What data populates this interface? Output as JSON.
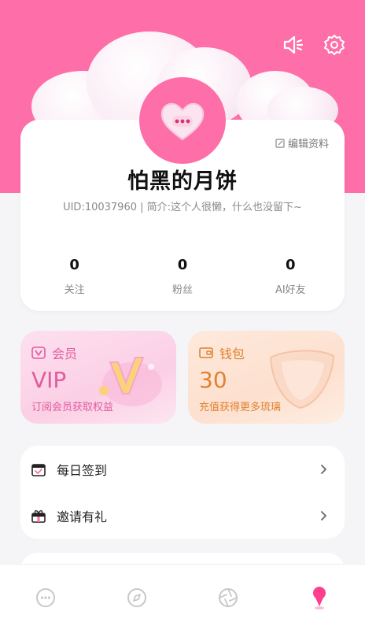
{
  "header": {
    "top_icons": [
      "speaker-icon",
      "gear-icon"
    ],
    "accent_color": "#fe6ea8"
  },
  "profile": {
    "edit_label": "编辑资料",
    "nickname": "怕黑的月饼",
    "uid_line": "UID:10037960 | 简介:这个人很懒，什么也没留下~",
    "stats": [
      {
        "value": "0",
        "label": "关注"
      },
      {
        "value": "0",
        "label": "粉丝"
      },
      {
        "value": "0",
        "label": "AI好友"
      }
    ]
  },
  "vip_card": {
    "title": "会员",
    "big_text": "VIP",
    "subtitle": "订阅会员获取权益",
    "color": "#e05c9e"
  },
  "wallet_card": {
    "title": "钱包",
    "big_text": "30",
    "subtitle": "充值获得更多琉璃",
    "color": "#e0822f"
  },
  "menu": {
    "items": [
      {
        "label": "每日签到",
        "icon": "calendar-icon"
      },
      {
        "label": "邀请有礼",
        "icon": "gift-icon"
      }
    ]
  },
  "bottom_nav": {
    "items": [
      "chat-icon",
      "compass-icon",
      "aperture-icon",
      "profile-pin-icon"
    ],
    "active_index": 3
  }
}
